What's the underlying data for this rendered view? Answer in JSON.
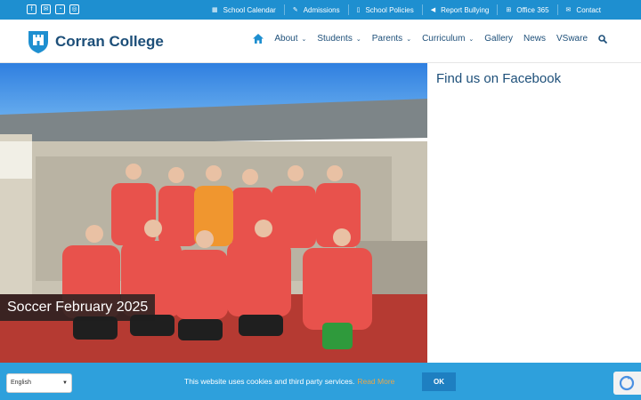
{
  "social": {
    "icons": [
      "facebook-icon",
      "email-icon",
      "rss-icon",
      "instagram-icon"
    ]
  },
  "topbar": {
    "links": [
      {
        "label": "School Calendar",
        "icon": "calendar-icon"
      },
      {
        "label": "Admissions",
        "icon": "pencil-icon"
      },
      {
        "label": "School Policies",
        "icon": "document-icon"
      },
      {
        "label": "Report Bullying",
        "icon": "megaphone-icon"
      },
      {
        "label": "Office 365",
        "icon": "windows-icon"
      },
      {
        "label": "Contact",
        "icon": "envelope-icon"
      }
    ]
  },
  "header": {
    "logo_text": "Corran College",
    "nav": [
      {
        "label": "About",
        "dropdown": true
      },
      {
        "label": "Students",
        "dropdown": true
      },
      {
        "label": "Parents",
        "dropdown": true
      },
      {
        "label": "Curriculum",
        "dropdown": true
      },
      {
        "label": "Gallery",
        "dropdown": false
      },
      {
        "label": "News",
        "dropdown": false
      },
      {
        "label": "VSware",
        "dropdown": false
      }
    ]
  },
  "hero": {
    "caption": "Soccer February 2025"
  },
  "sidebar": {
    "title": "Find us on Facebook"
  },
  "cookie": {
    "text": "This website uses cookies and third party services.",
    "link": "Read More",
    "ok": "OK"
  },
  "language": {
    "selected": "English"
  },
  "colors": {
    "topbar": "#1e8fd0",
    "navy": "#1d4f79",
    "cookie": "#2ea0dc"
  }
}
